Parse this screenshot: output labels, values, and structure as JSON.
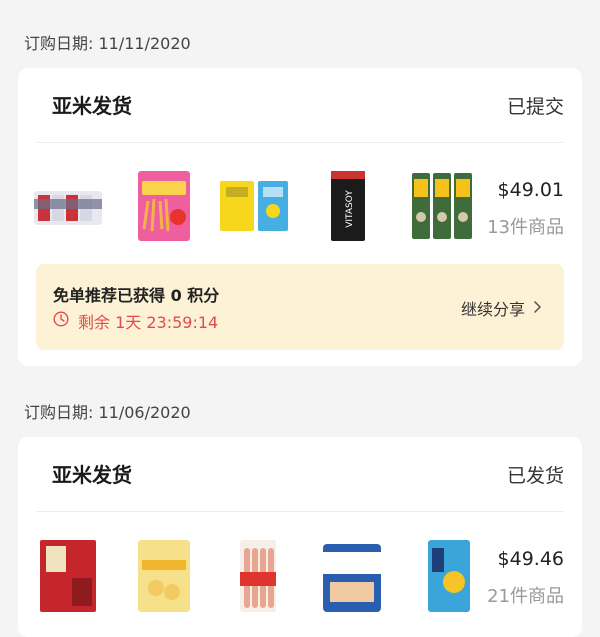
{
  "orders": [
    {
      "date_label": "订购日期: 11/11/2020",
      "seller": "亚米发货",
      "status": "已提交",
      "price": "$49.01",
      "item_count": "13件商品",
      "reward": {
        "title": "免单推荐已获得 0 积分",
        "timer": "剩余 1天 23:59:14",
        "share_label": "继续分享"
      }
    },
    {
      "date_label": "订购日期: 11/06/2020",
      "seller": "亚米发货",
      "status": "已发货",
      "price": "$49.46",
      "item_count": "21件商品"
    }
  ],
  "icons": {
    "clock": "clock-icon",
    "chevron": "chevron-right-icon"
  },
  "colors": {
    "timer_red": "#e34b4b",
    "reward_bg": "#fdf2d6",
    "seller_underline": "#ec6e6e"
  }
}
